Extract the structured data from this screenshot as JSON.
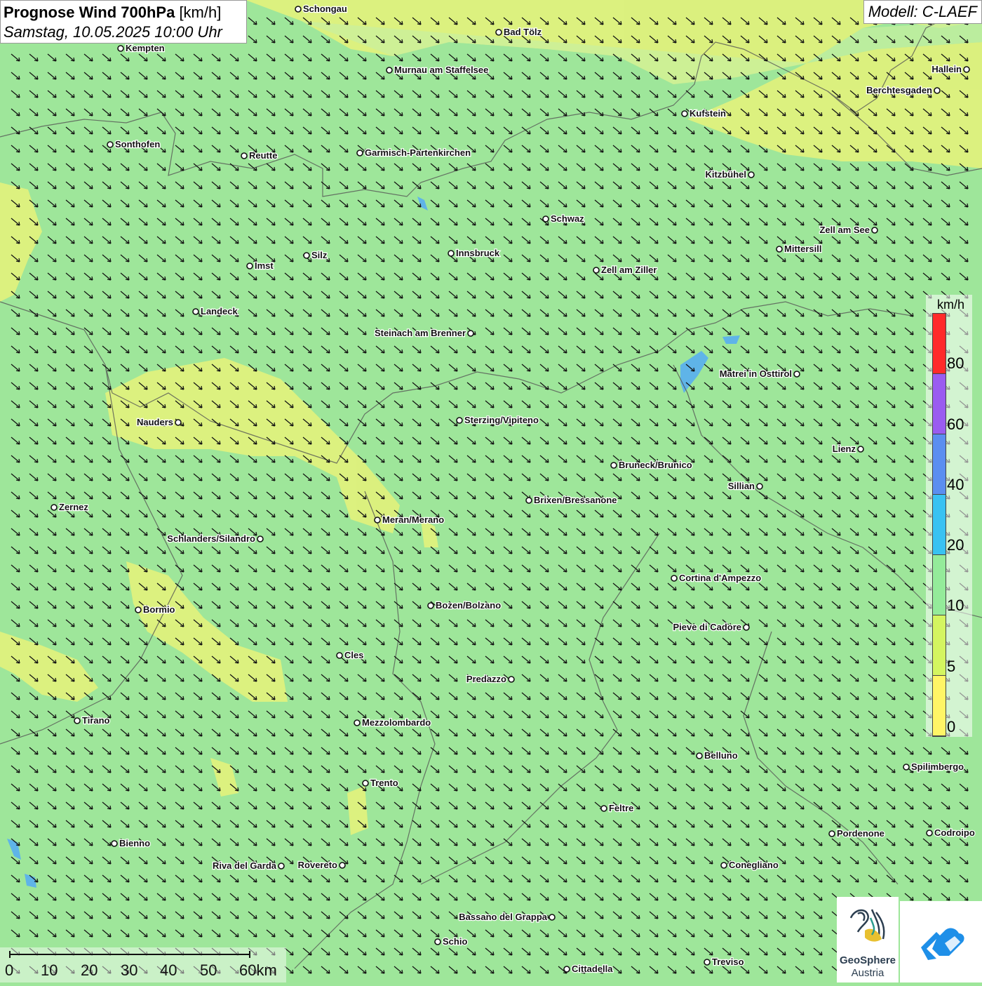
{
  "title": {
    "bold": "Prognose Wind 700hPa",
    "unit": "[km/h]",
    "datetime": "Samstag, 10.05.2025 10:00 Uhr"
  },
  "model_label": "Modell: C-LAEF",
  "legend": {
    "unit": "km/h",
    "ticks": [
      "80",
      "60",
      "40",
      "20",
      "10",
      "5",
      "0"
    ],
    "colors": [
      "#ff2a2a",
      "#9a5cf0",
      "#5b8ef0",
      "#39c2f2",
      "#94eb9a",
      "#d4f560",
      "#fff566"
    ]
  },
  "scale_bar": {
    "labels": [
      "0",
      "10",
      "20",
      "30",
      "40",
      "50",
      "60km"
    ]
  },
  "logos": {
    "geosphere_line1": "GeoSphere",
    "geosphere_line2": "Austria"
  },
  "cities": [
    {
      "name": "Schongau",
      "side": "right"
    },
    {
      "name": "Bad Tölz",
      "side": "right"
    },
    {
      "name": "Kempten",
      "side": "right"
    },
    {
      "name": "Murnau am Staffelsee",
      "side": "right"
    },
    {
      "name": "Hallein",
      "side": "left"
    },
    {
      "name": "Berchtesgaden",
      "side": "left"
    },
    {
      "name": "Kufstein",
      "side": "right"
    },
    {
      "name": "Sonthofen",
      "side": "right"
    },
    {
      "name": "Reutte",
      "side": "right"
    },
    {
      "name": "Garmisch-Partenkirchen",
      "side": "right"
    },
    {
      "name": "Kitzbühel",
      "side": "left"
    },
    {
      "name": "Schwaz",
      "side": "right"
    },
    {
      "name": "Zell am See",
      "side": "left"
    },
    {
      "name": "Mittersill",
      "side": "right"
    },
    {
      "name": "Innsbruck",
      "side": "right"
    },
    {
      "name": "Silz",
      "side": "right"
    },
    {
      "name": "Imst",
      "side": "right"
    },
    {
      "name": "Zell am Ziller",
      "side": "right"
    },
    {
      "name": "Landeck",
      "side": "right"
    },
    {
      "name": "Steinach am Brenner",
      "side": "left"
    },
    {
      "name": "Matrei in Osttirol",
      "side": "left"
    },
    {
      "name": "Nauders",
      "side": "left"
    },
    {
      "name": "Sterzing/Vipiteno",
      "side": "right"
    },
    {
      "name": "Lienz",
      "side": "left"
    },
    {
      "name": "Bruneck/Brunico",
      "side": "right"
    },
    {
      "name": "Sillian",
      "side": "left"
    },
    {
      "name": "Brixen/Bressanone",
      "side": "right"
    },
    {
      "name": "Zernez",
      "side": "right"
    },
    {
      "name": "Meran/Merano",
      "side": "right"
    },
    {
      "name": "Schlanders/Silandro",
      "side": "left"
    },
    {
      "name": "Cortina d'Ampezzo",
      "side": "right"
    },
    {
      "name": "Bozen/Bolzano",
      "side": "right"
    },
    {
      "name": "Bormio",
      "side": "right"
    },
    {
      "name": "Pieve di Cadore",
      "side": "left"
    },
    {
      "name": "Cles",
      "side": "right"
    },
    {
      "name": "Predazzo",
      "side": "left"
    },
    {
      "name": "Tirano",
      "side": "right"
    },
    {
      "name": "Mezzolombardo",
      "side": "right"
    },
    {
      "name": "Belluno",
      "side": "right"
    },
    {
      "name": "Spilimbergo",
      "side": "right"
    },
    {
      "name": "Trento",
      "side": "right"
    },
    {
      "name": "Feltre",
      "side": "right"
    },
    {
      "name": "Pordenone",
      "side": "right"
    },
    {
      "name": "Codroipo",
      "side": "right"
    },
    {
      "name": "Bienno",
      "side": "right"
    },
    {
      "name": "Riva del Garda",
      "side": "left"
    },
    {
      "name": "Rovereto",
      "side": "left"
    },
    {
      "name": "Conegliano",
      "side": "right"
    },
    {
      "name": "Bassano del Grappa",
      "side": "left"
    },
    {
      "name": "Schio",
      "side": "right"
    },
    {
      "name": "Treviso",
      "side": "right"
    },
    {
      "name": "Cittadella",
      "side": "right"
    }
  ]
}
